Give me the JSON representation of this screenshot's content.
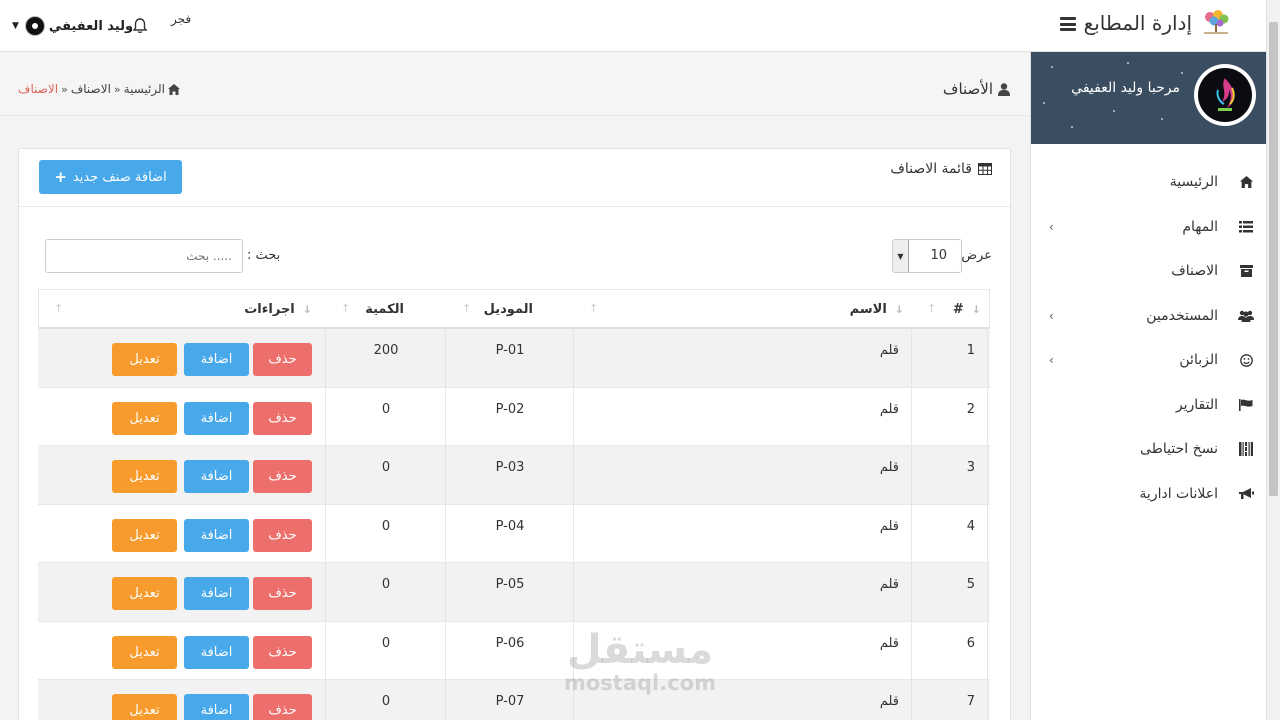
{
  "topbar": {
    "brand_title": "إدارة المطابع",
    "user_name": "وليد العفيفي",
    "notification_text": "فجر"
  },
  "sidebar": {
    "greeting": "مرحبا وليد العفيفي",
    "items": [
      {
        "label": "الرئيسية",
        "icon": "home-icon",
        "has_submenu": false
      },
      {
        "label": "المهام",
        "icon": "list-icon",
        "has_submenu": true
      },
      {
        "label": "الاصناف",
        "icon": "archive-icon",
        "has_submenu": false
      },
      {
        "label": "المستخدمين",
        "icon": "users-icon",
        "has_submenu": true
      },
      {
        "label": "الزبائن",
        "icon": "smile-icon",
        "has_submenu": true
      },
      {
        "label": "التقارير",
        "icon": "flag-icon",
        "has_submenu": false
      },
      {
        "label": "نسخ احتياطى",
        "icon": "qrcode-icon",
        "has_submenu": false
      },
      {
        "label": "اعلانات ادارية",
        "icon": "bullhorn-icon",
        "has_submenu": false
      }
    ]
  },
  "page": {
    "title": "الأصناف",
    "breadcrumb": {
      "home": "الرئيسية",
      "parent": "الاصناف",
      "current": "الاصناف"
    }
  },
  "card": {
    "title": "قائمة الاصناف",
    "add_button": "اضافة صنف جديد"
  },
  "controls": {
    "length_label": "عرض",
    "length_value": "10",
    "search_label": "بحث :",
    "search_placeholder": "بحث ....."
  },
  "table": {
    "headers": {
      "index": "#",
      "name": "الاسم",
      "model": "الموديل",
      "qty": "الكمية",
      "actions": "اجراءات"
    },
    "actions": {
      "delete": "حذف",
      "add": "اضافة",
      "edit": "تعديل"
    },
    "rows": [
      {
        "index": "1",
        "name": "قلم",
        "model": "P-01",
        "qty": "200"
      },
      {
        "index": "2",
        "name": "قلم",
        "model": "P-02",
        "qty": "0"
      },
      {
        "index": "3",
        "name": "قلم",
        "model": "P-03",
        "qty": "0"
      },
      {
        "index": "4",
        "name": "قلم",
        "model": "P-04",
        "qty": "0"
      },
      {
        "index": "5",
        "name": "قلم",
        "model": "P-05",
        "qty": "0"
      },
      {
        "index": "6",
        "name": "قلم",
        "model": "P-06",
        "qty": "0"
      },
      {
        "index": "7",
        "name": "قلم",
        "model": "P-07",
        "qty": "0"
      }
    ]
  },
  "watermark": {
    "arabic": "مستقل",
    "latin": "mostaql.com"
  },
  "colors": {
    "sidebar_header": "#3a4d61",
    "primary": "#47a8ea",
    "danger": "#ec6f6b",
    "warning": "#f79c2c",
    "breadcrumb_active": "#e0675a"
  }
}
